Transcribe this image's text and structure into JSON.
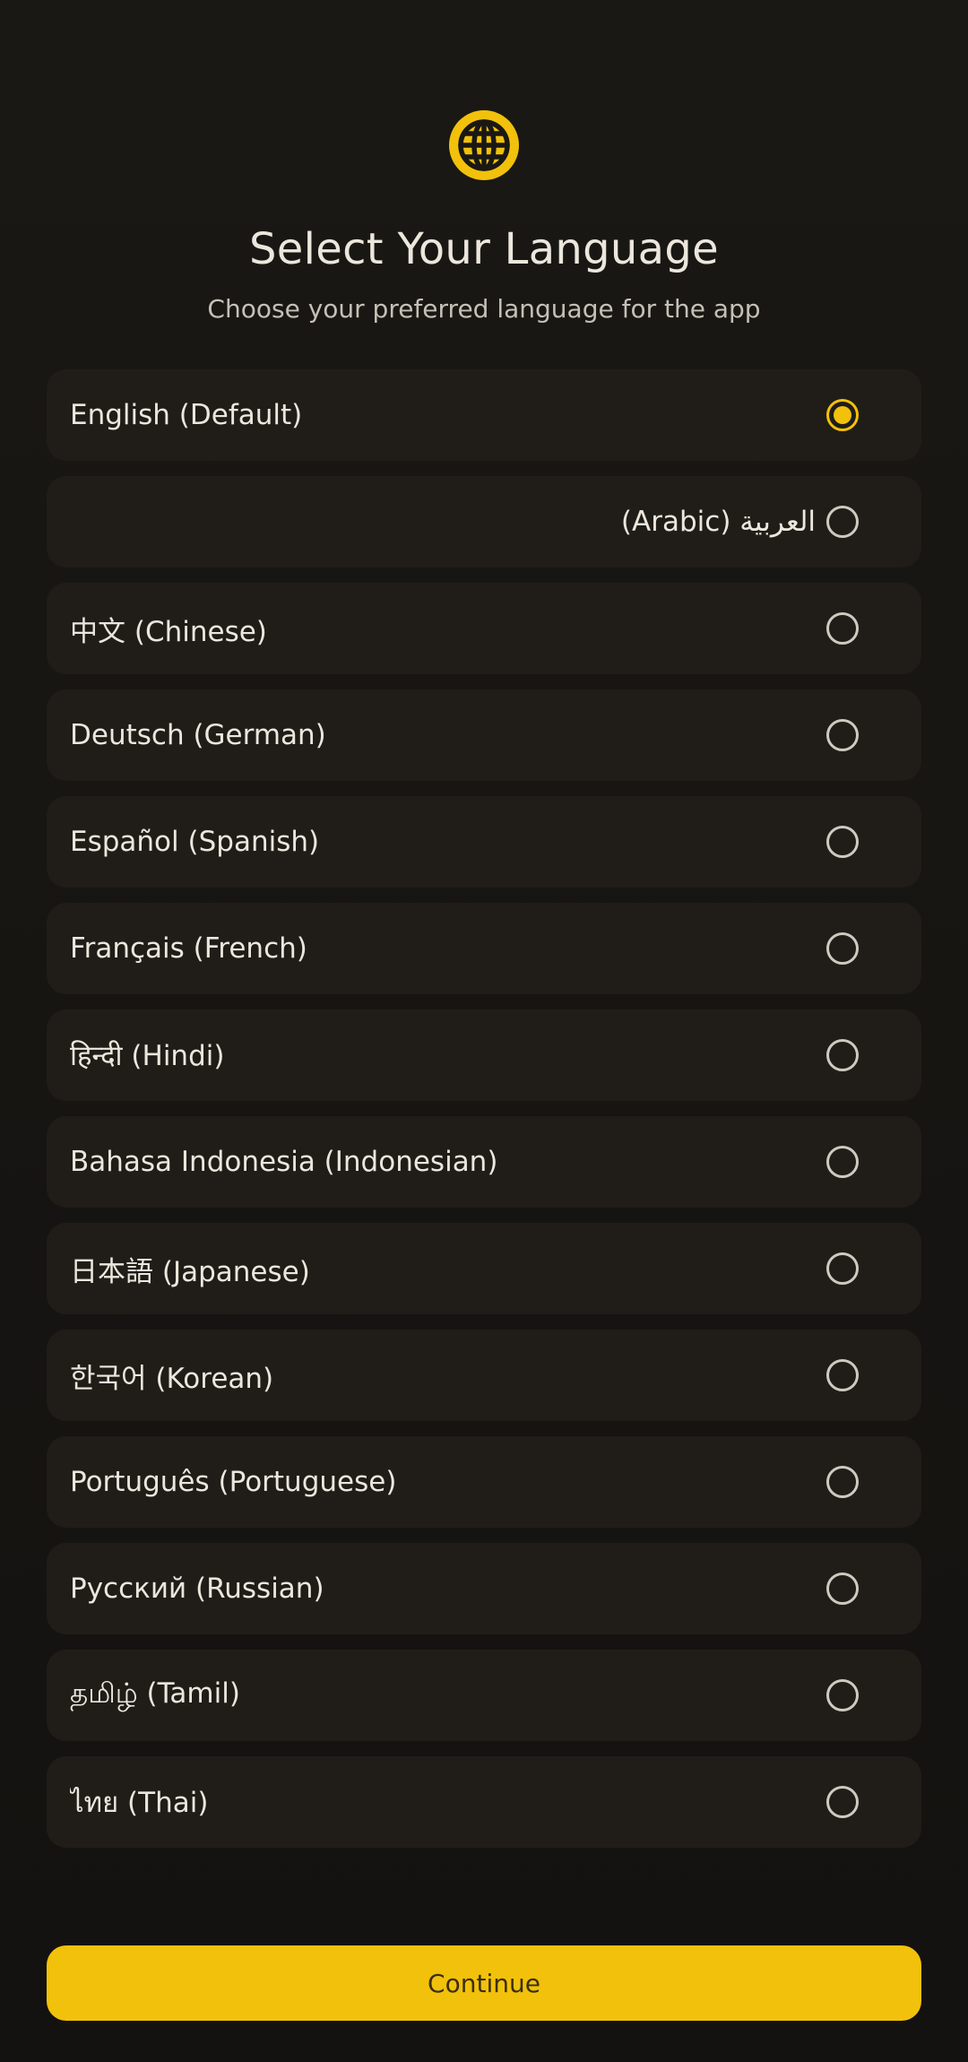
{
  "header": {
    "icon": "globe-icon",
    "title": "Select Your Language",
    "subtitle": "Choose your preferred language for the app"
  },
  "languages": [
    {
      "label": "English (Default)",
      "selected": true,
      "rtl": false
    },
    {
      "label": "العربية (Arabic)",
      "selected": false,
      "rtl": true
    },
    {
      "label": "中文 (Chinese)",
      "selected": false,
      "rtl": false
    },
    {
      "label": "Deutsch (German)",
      "selected": false,
      "rtl": false
    },
    {
      "label": "Español (Spanish)",
      "selected": false,
      "rtl": false
    },
    {
      "label": "Français (French)",
      "selected": false,
      "rtl": false
    },
    {
      "label": "हिन्दी (Hindi)",
      "selected": false,
      "rtl": false
    },
    {
      "label": "Bahasa Indonesia (Indonesian)",
      "selected": false,
      "rtl": false
    },
    {
      "label": "日本語 (Japanese)",
      "selected": false,
      "rtl": false
    },
    {
      "label": "한국어 (Korean)",
      "selected": false,
      "rtl": false
    },
    {
      "label": "Português (Portuguese)",
      "selected": false,
      "rtl": false
    },
    {
      "label": "Русский (Russian)",
      "selected": false,
      "rtl": false
    },
    {
      "label": "தமிழ் (Tamil)",
      "selected": false,
      "rtl": false
    },
    {
      "label": "ไทย (Thai)",
      "selected": false,
      "rtl": false
    }
  ],
  "footer": {
    "continue_label": "Continue"
  },
  "colors": {
    "accent": "#f2c10b",
    "background": "#141210",
    "card": "#201d19",
    "text": "#ece7dd"
  }
}
